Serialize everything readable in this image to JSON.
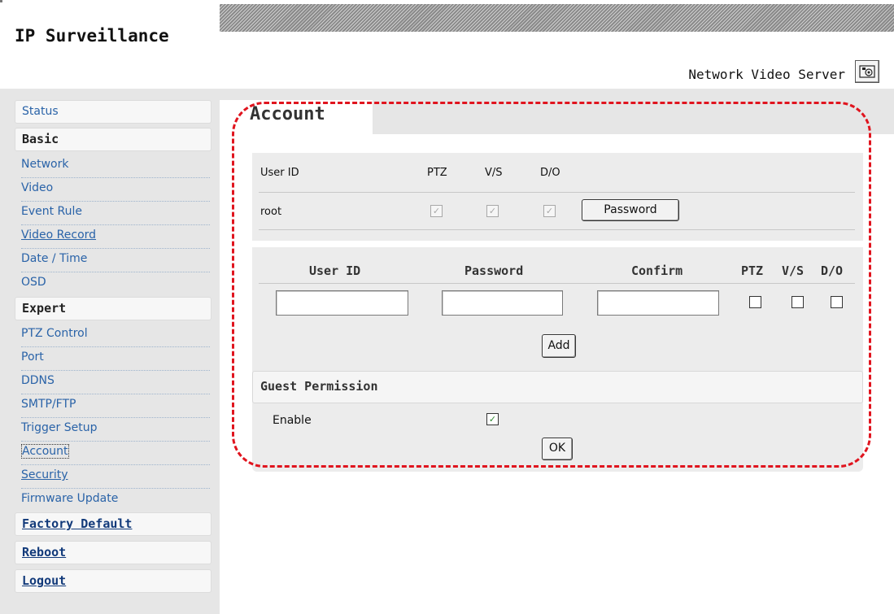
{
  "header": {
    "brand": "IP Surveillance",
    "device_name": "Network Video Server",
    "snapshot_icon": "camera-icon"
  },
  "sidebar": {
    "status": "Status",
    "basic_heading": "Basic",
    "basic_items": [
      {
        "label": "Network"
      },
      {
        "label": "Video"
      },
      {
        "label": "Event Rule"
      },
      {
        "label": "Video Record"
      },
      {
        "label": "Date / Time"
      },
      {
        "label": "OSD"
      }
    ],
    "expert_heading": "Expert",
    "expert_items": [
      {
        "label": "PTZ Control"
      },
      {
        "label": "Port"
      },
      {
        "label": "DDNS"
      },
      {
        "label": "SMTP/FTP"
      },
      {
        "label": "Trigger Setup"
      },
      {
        "label": "Account"
      },
      {
        "label": "Security"
      },
      {
        "label": "Firmware Update"
      }
    ],
    "factory_default": "Factory Default",
    "reboot": "Reboot",
    "logout": "Logout"
  },
  "main": {
    "title": "Account",
    "users_table": {
      "headers": [
        "User ID",
        "PTZ",
        "V/S",
        "D/O"
      ],
      "rows": [
        {
          "user_id": "root",
          "ptz": true,
          "vs": true,
          "do": true,
          "button": "Password"
        }
      ]
    },
    "add_form": {
      "headers": [
        "User ID",
        "Password",
        "Confirm",
        "PTZ",
        "V/S",
        "D/O"
      ],
      "user_id_value": "",
      "password_value": "",
      "confirm_value": "",
      "ptz": false,
      "vs": false,
      "do": false,
      "add_button": "Add"
    },
    "guest": {
      "heading": "Guest Permission",
      "enable_label": "Enable",
      "enabled": true,
      "ok_button": "OK"
    }
  },
  "colors": {
    "sidebar_link": "#2a63a8",
    "sidebar_bold_link": "#123a7a",
    "annotation_dash": "#e0141e",
    "check_green": "#2f8a2f"
  }
}
